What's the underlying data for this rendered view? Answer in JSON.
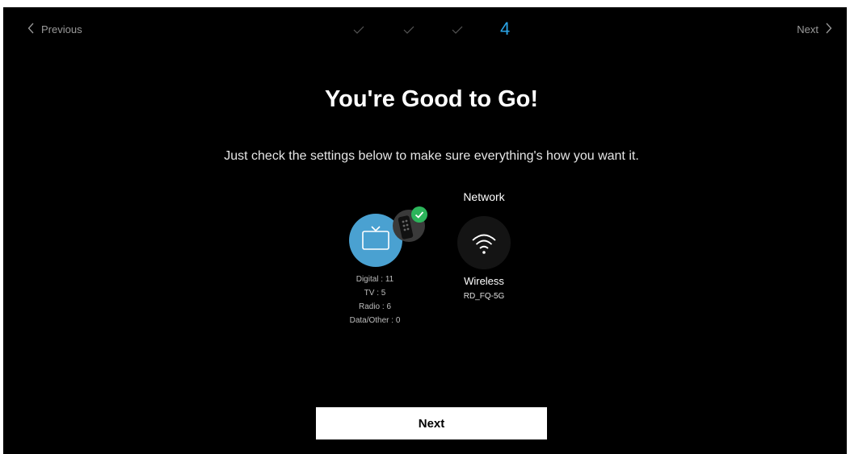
{
  "nav": {
    "previous_label": "Previous",
    "next_label": "Next",
    "current_step": "4"
  },
  "heading": {
    "title": "You're Good to Go!",
    "subtitle": "Just check the settings below to make sure everything's how you want it."
  },
  "channels": {
    "stats": [
      "Digital : 11",
      "TV : 5",
      "Radio : 6",
      "Data/Other : 0"
    ],
    "icons": {
      "main": "tv-icon",
      "secondary": "remote-icon",
      "badge": "check-icon"
    }
  },
  "network": {
    "title": "Network",
    "type": "Wireless",
    "ssid": "RD_FQ-5G",
    "icon": "wifi-icon"
  },
  "footer": {
    "next_button_label": "Next"
  },
  "colors": {
    "background": "#000000",
    "accent": "#2aa5e8",
    "tv_circle": "#4aa1d1",
    "success": "#2cb55b",
    "button": "#ffffff"
  }
}
